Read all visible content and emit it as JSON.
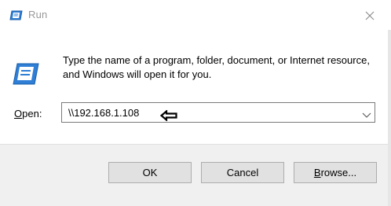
{
  "window": {
    "title": "Run",
    "close_icon": "close-icon",
    "app_icon": "run-app-icon"
  },
  "description": "Type the name of a program, folder, document, or Internet resource, and Windows will open it for you.",
  "open_field": {
    "label_mnemonic": "O",
    "label_rest": "pen:",
    "value": "\\\\192.168.1.108",
    "dropdown_icon": "chevron-down-icon"
  },
  "annotation": {
    "icon": "left-arrow-icon"
  },
  "buttons": {
    "ok": "OK",
    "cancel": "Cancel",
    "browse_mnemonic": "B",
    "browse_rest": "rowse..."
  },
  "colors": {
    "footer_bg": "#f0f0f0",
    "button_bg": "#e1e1e1",
    "title_text": "#999999",
    "icon_blue": "#1e6fc9"
  }
}
